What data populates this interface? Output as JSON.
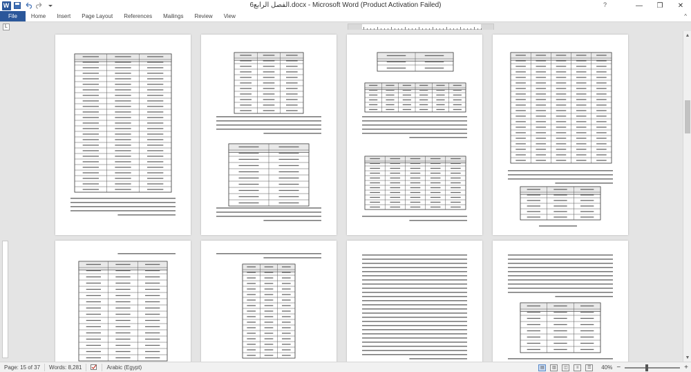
{
  "window": {
    "title": "6الفصل الرابع.docx  -  Microsoft Word (Product Activation Failed)",
    "logo_letter": "W",
    "help": "?",
    "minimize": "—",
    "restore": "❐",
    "close": "✕"
  },
  "qat": {
    "save_icon": "save-icon",
    "undo_icon": "undo-icon",
    "redo_icon": "redo-icon",
    "customize_icon": "customize-icon"
  },
  "ribbon": {
    "tabs": [
      "File",
      "Home",
      "Insert",
      "Page Layout",
      "References",
      "Mailings",
      "Review",
      "View"
    ],
    "collapse": "^"
  },
  "ruler": {
    "tab_selector": "L"
  },
  "status": {
    "page": "Page: 15 of 37",
    "words": "Words: 8,281",
    "language": "Arabic (Egypt)",
    "zoom": "40%",
    "zoom_minus": "−",
    "zoom_plus": "+",
    "zoom_fraction": 0.4
  },
  "colors": {
    "accent": "#2b579a",
    "page_bg": "#ffffff",
    "canvas": "#e4e4e4"
  }
}
